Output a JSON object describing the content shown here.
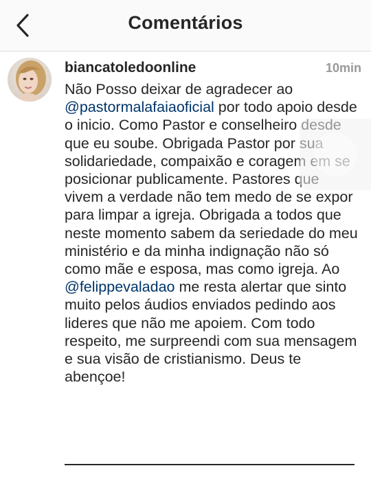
{
  "header": {
    "title": "Comentários",
    "back_icon": "chevron-left-icon"
  },
  "comment": {
    "username": "biancatoledoonline",
    "time": "10min",
    "avatar_icon": "avatar-photo",
    "text_part1": "Não Posso deixar de agradecer ao ",
    "mention1": "@pastormalafaiaoficial",
    "text_part2": " por todo apoio desde o inicio. Como Pastor e conselheiro desde que eu soube. Obrigada Pastor por sua solidariedade, compaixão e coragem em se posicionar publicamente. Pastores que vivem a verdade não tem medo de se expor para limpar a igreja. Obrigada a todos que neste momento sabem da seriedade do meu ministério e da minha indignação não só como mãe e esposa, mas como igreja. Ao ",
    "mention2": "@felippevaladao",
    "text_part3": " me resta alertar que sinto muito pelos áudios enviados pedindo aos lideres que não me apoiem. Com todo respeito, me surpreendi com sua mensagem e sua visão de cristianismo. Deus te abençoe!"
  },
  "colors": {
    "text": "#262626",
    "mention": "#003569",
    "time": "#999999",
    "header_bg": "#fafafa"
  }
}
